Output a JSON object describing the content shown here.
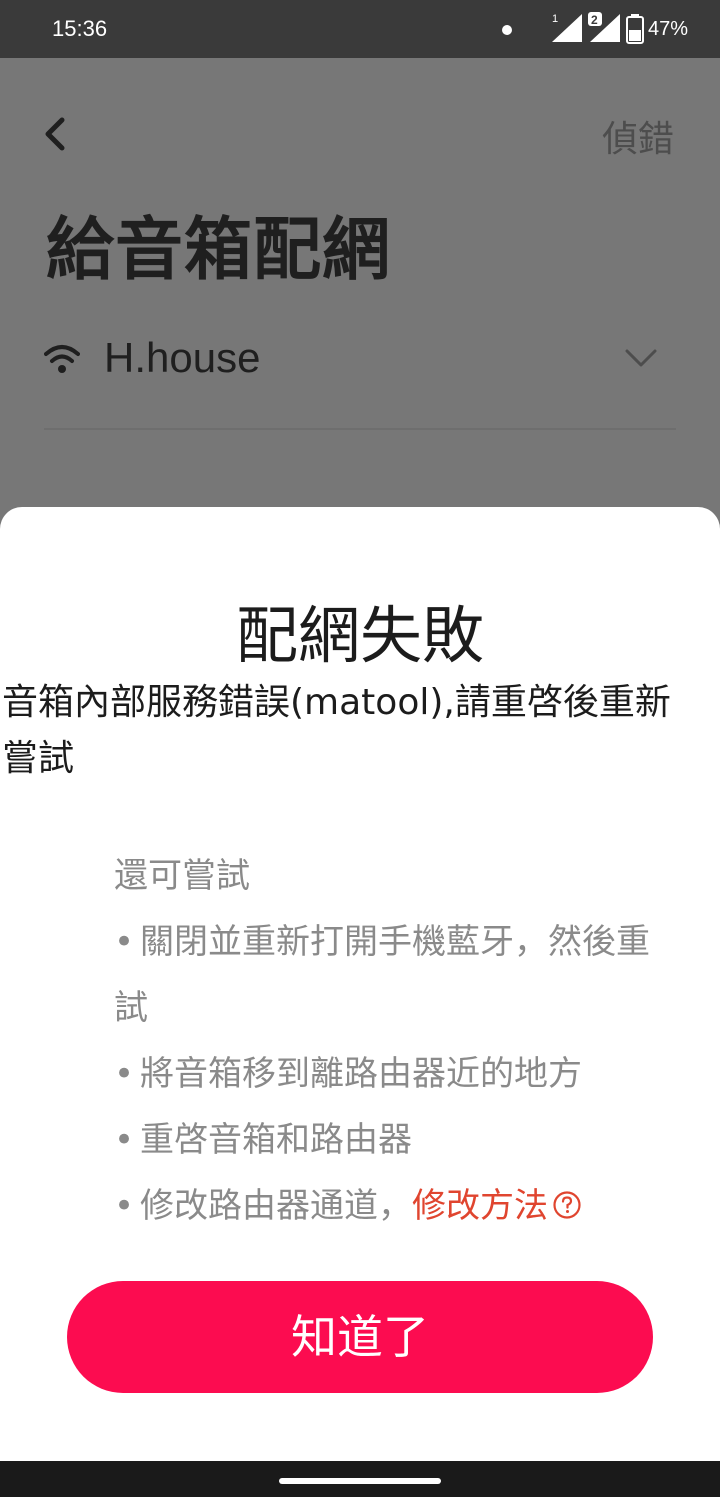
{
  "status_bar": {
    "time": "15:36",
    "sim1_label": "1",
    "sim2_label": "2",
    "battery": "47%"
  },
  "page": {
    "debug_label": "偵錯",
    "title": "給音箱配網",
    "wifi_name": "H.house"
  },
  "dialog": {
    "title": "配網失敗",
    "message": "音箱內部服務錯誤(matool),請重啓後重新嘗試",
    "tips_heading": "還可嘗試",
    "tips": [
      {
        "bullet": "•",
        "line1": "關閉並重新打開手機藍牙，然後重",
        "line2": "試"
      },
      {
        "bullet": "•",
        "text": "將音箱移到離路由器近的地方"
      },
      {
        "bullet": "•",
        "text": "重啓音箱和路由器"
      },
      {
        "bullet": "•",
        "text": "修改路由器通道，",
        "link": "修改方法"
      }
    ],
    "ok_label": "知道了"
  },
  "colors": {
    "accent": "#fc0c50",
    "link": "#e0452f",
    "overlay": "#777777"
  }
}
